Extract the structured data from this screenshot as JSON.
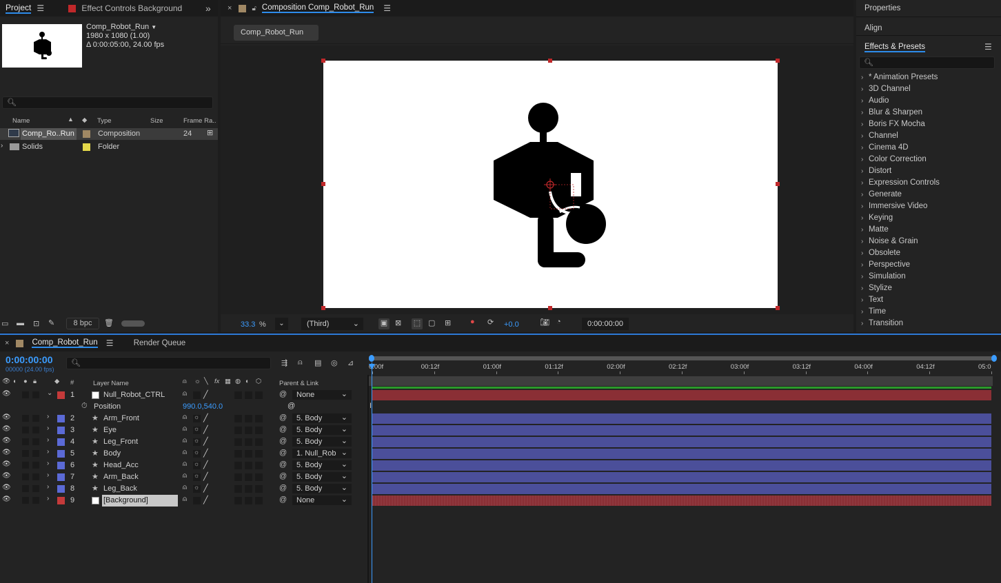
{
  "project_panel": {
    "tab_project": "Project",
    "tab_effect_controls": "Effect Controls Background",
    "comp_name": "Comp_Robot_Run",
    "comp_resolution": "1980 x 1080 (1.00)",
    "comp_duration": "Δ 0:00:05:00, 24.00 fps",
    "search_placeholder": "",
    "columns": [
      "Name",
      "Type",
      "Size",
      "Frame Ra.."
    ],
    "items": [
      {
        "name": "Comp_Ro..Run",
        "type": "Composition",
        "size": "",
        "frame_rate": "24",
        "label_color": "#a08864"
      },
      {
        "name": "Solids",
        "type": "Folder",
        "size": "",
        "frame_rate": "",
        "label_color": "#e4d84a"
      }
    ],
    "bpc": "8 bpc"
  },
  "composition_panel": {
    "tab_title": "Composition Comp_Robot_Run",
    "breadcrumb": "Comp_Robot_Run",
    "zoom": "33.3",
    "zoom_unit": "%",
    "view": "(Third)",
    "exposure": "+0.0",
    "timecode": "0:00:00:00"
  },
  "right_panel": {
    "properties": "Properties",
    "align": "Align",
    "effects_title": "Effects & Presets",
    "effects": [
      "* Animation Presets",
      "3D Channel",
      "Audio",
      "Blur & Sharpen",
      "Boris FX Mocha",
      "Channel",
      "Cinema 4D",
      "Color Correction",
      "Distort",
      "Expression Controls",
      "Generate",
      "Immersive Video",
      "Keying",
      "Matte",
      "Noise & Grain",
      "Obsolete",
      "Perspective",
      "Simulation",
      "Stylize",
      "Text",
      "Time",
      "Transition"
    ]
  },
  "timeline": {
    "tab_comp": "Comp_Robot_Run",
    "tab_render": "Render Queue",
    "current_time": "0:00:00:00",
    "frame_info": "00000 (24.00 fps)",
    "col_layer_name": "Layer Name",
    "col_parent": "Parent & Link",
    "col_hash": "#",
    "ruler": [
      "0:00f",
      "00:12f",
      "01:00f",
      "01:12f",
      "02:00f",
      "02:12f",
      "03:00f",
      "03:12f",
      "04:00f",
      "04:12f",
      "05:0"
    ],
    "position_label": "Position",
    "position_value_x": "990.0",
    "position_value_y": "540.0",
    "layers": [
      {
        "num": "1",
        "name": "Null_Robot_CTRL",
        "parent": "None",
        "label": "#c43a3a",
        "type": "null"
      },
      {
        "num": "2",
        "name": "Arm_Front",
        "parent": "5. Body",
        "label": "#5b6ad6",
        "type": "shape"
      },
      {
        "num": "3",
        "name": "Eye",
        "parent": "5. Body",
        "label": "#5b6ad6",
        "type": "shape"
      },
      {
        "num": "4",
        "name": "Leg_Front",
        "parent": "5. Body",
        "label": "#5b6ad6",
        "type": "shape"
      },
      {
        "num": "5",
        "name": "Body",
        "parent": "1. Null_Rob",
        "label": "#5b6ad6",
        "type": "shape"
      },
      {
        "num": "6",
        "name": "Head_Acc",
        "parent": "5. Body",
        "label": "#5b6ad6",
        "type": "shape"
      },
      {
        "num": "7",
        "name": "Arm_Back",
        "parent": "5. Body",
        "label": "#5b6ad6",
        "type": "shape"
      },
      {
        "num": "8",
        "name": "Leg_Back",
        "parent": "5. Body",
        "label": "#5b6ad6",
        "type": "shape"
      },
      {
        "num": "9",
        "name": "[Background]",
        "parent": "None",
        "label": "#c43a3a",
        "type": "solid"
      }
    ]
  },
  "colors": {
    "accent_blue": "#2d8ceb",
    "layer_bar_blue": "#4b4f9a",
    "layer_bar_red": "#8a2f35",
    "handle_red": "#c0282a"
  }
}
